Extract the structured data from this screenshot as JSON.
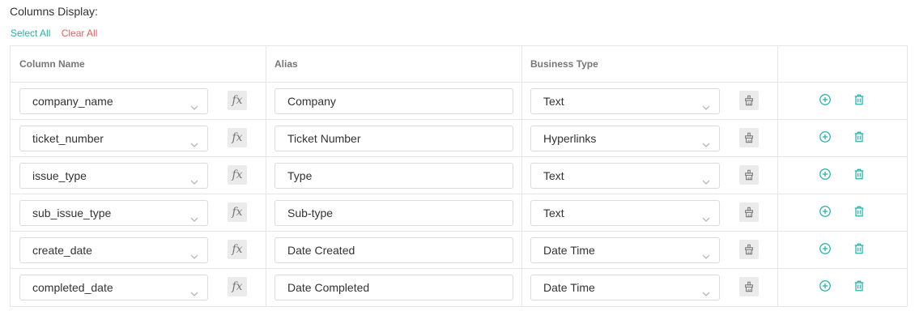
{
  "section_title": "Columns Display:",
  "actions": {
    "select_all": "Select All",
    "clear_all": "Clear All"
  },
  "headers": {
    "column_name": "Column Name",
    "alias": "Alias",
    "business_type": "Business Type",
    "actions": ""
  },
  "icons": {
    "chevron": "chevron-down-icon",
    "formula": "function-fx-icon",
    "format": "format-brush-icon",
    "add": "add-circle-icon",
    "delete": "trash-icon"
  },
  "colors": {
    "accent": "#20b2aa",
    "danger": "#f05a5a",
    "border": "#e6e6e6"
  },
  "formula_label": "fx",
  "rows": [
    {
      "column": "company_name",
      "alias": "Company",
      "business_type": "Text"
    },
    {
      "column": "ticket_number",
      "alias": "Ticket Number",
      "business_type": "Hyperlinks"
    },
    {
      "column": "issue_type",
      "alias": "Type",
      "business_type": "Text"
    },
    {
      "column": "sub_issue_type",
      "alias": "Sub-type",
      "business_type": "Text"
    },
    {
      "column": "create_date",
      "alias": "Date Created",
      "business_type": "Date Time"
    },
    {
      "column": "completed_date",
      "alias": "Date Completed",
      "business_type": "Date Time"
    }
  ]
}
